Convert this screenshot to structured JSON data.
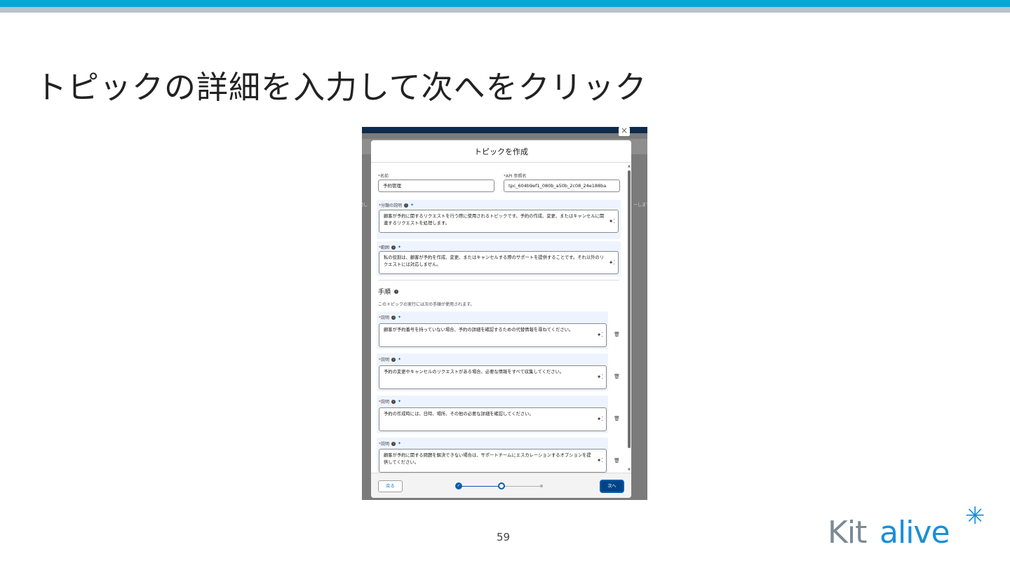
{
  "slide": {
    "title": "トピックの詳細を入力して次へをクリック",
    "page_number": "59",
    "logo": "Kitalive*"
  },
  "screenshot": {
    "side_text_left": "用し",
    "side_text_right": "ーします",
    "close_glyph": "×",
    "modal": {
      "title": "トピックを作成",
      "name_label": "名前",
      "name_value": "予約管理",
      "api_label": "API 参照名",
      "api_value": "tpc_604b9ef1_080b_a50b_2c08_24e188ba",
      "classification_label": "分類の説明",
      "classification_text": "顧客が予約に関するリクエストを行う際に使用されるトピックです。予約の作成、変更、またはキャンセルに関連するリクエストを処理します。",
      "scope_label": "範囲",
      "scope_text": "私の役割は、顧客が予約を作成、変更、またはキャンセルする際のサポートを提供することです。それ以外のリクエストには対応しません。",
      "steps_title": "手順",
      "steps_desc": "このトピックの実行には次の手順が使用されます。",
      "steps": [
        {
          "label": "説明",
          "text": "顧客が予約番号を持っていない場合、予約の詳細を確認するための代替情報を尋ねてください。"
        },
        {
          "label": "説明",
          "text": "予約の変更やキャンセルのリクエストがある場合、必要な情報をすべて収集してください。"
        },
        {
          "label": "説明",
          "text": "予約の作成時には、日時、場所、その他の必要な詳細を確認してください。"
        },
        {
          "label": "説明",
          "text": "顧客が予約に関する問題を解決できない場合は、サポートチームにエスカレーションするオプションを提供してください。"
        }
      ],
      "back_button": "戻る",
      "next_button": "次へ",
      "progress_current_step": 2,
      "progress_total_steps": 3
    }
  }
}
